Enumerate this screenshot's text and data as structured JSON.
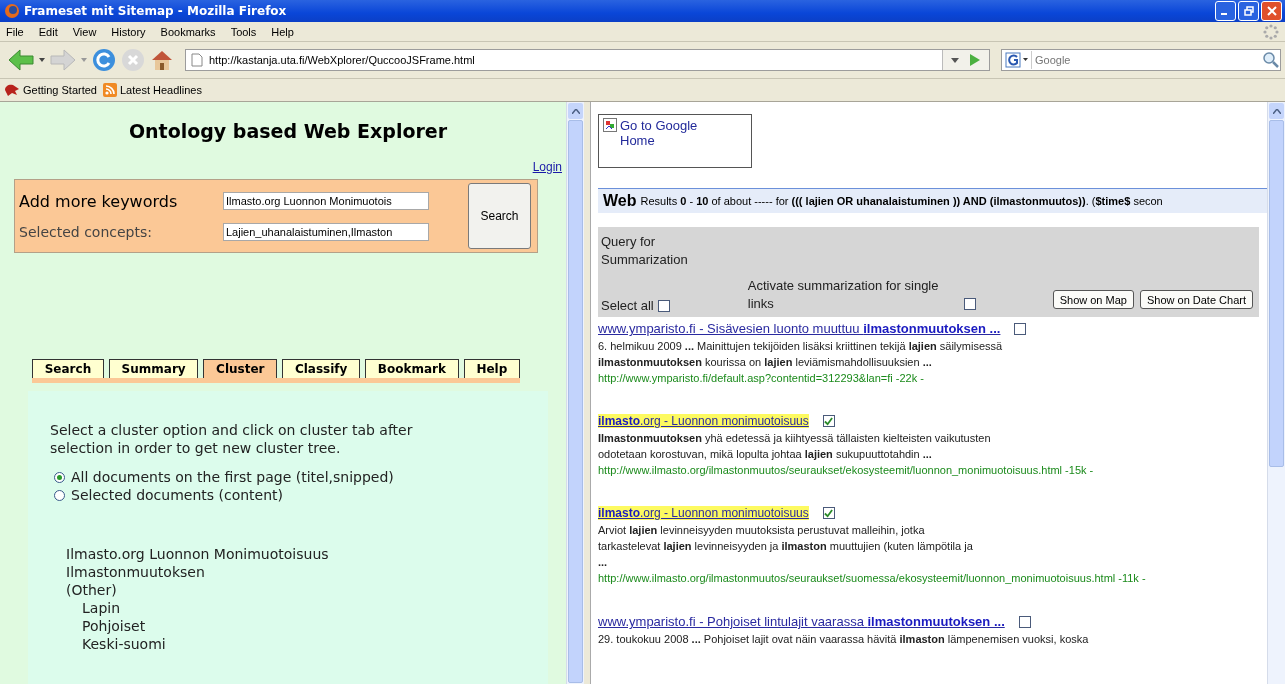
{
  "window": {
    "title": "Frameset mit Sitemap - Mozilla Firefox"
  },
  "menu": [
    "File",
    "Edit",
    "View",
    "History",
    "Bookmarks",
    "Tools",
    "Help"
  ],
  "address": {
    "url": "http://kastanja.uta.fi/WebXplorer/QuccooJSFrame.html"
  },
  "search": {
    "placeholder": "Google"
  },
  "bookmarks": [
    {
      "label": "Getting Started",
      "kind": "page"
    },
    {
      "label": "Latest Headlines",
      "kind": "feed"
    }
  ],
  "left": {
    "title": "Ontology based Web Explorer",
    "login": "Login",
    "keywords_label": "Add more keywords",
    "keywords_value": "Ilmasto.org Luonnon Monimuotois",
    "concepts_label": "Selected concepts:",
    "concepts_value": "Lajien_uhanalaistuminen,Ilmaston",
    "search_button": "Search",
    "tabs": [
      {
        "label": "Search",
        "selected": false
      },
      {
        "label": "Summary",
        "selected": false
      },
      {
        "label": "Cluster",
        "selected": true
      },
      {
        "label": "Classify",
        "selected": false
      },
      {
        "label": "Bookmark",
        "selected": false
      },
      {
        "label": "Help",
        "selected": false
      }
    ],
    "instructions": "Select a cluster option and click on cluster tab after selection in order to get new cluster tree.",
    "options": [
      {
        "label": "All documents on the first page (titel,snipped)",
        "selected": true
      },
      {
        "label": "Selected documents (content)",
        "selected": false
      }
    ],
    "tree": [
      {
        "label": "Ilmasto.org Luonnon Monimuotoisuus"
      },
      {
        "label": "Ilmastonmuutoksen"
      },
      {
        "label": "(Other)",
        "children": [
          {
            "label": "Lapin"
          },
          {
            "label": "Pohjoiset"
          },
          {
            "label": "Keski-suomi"
          }
        ]
      }
    ]
  },
  "right": {
    "home_link": "Go to Google Home",
    "web_label": "Web",
    "results_summary": "Results **0** - **10** of about ----- for **((( lajien OR uhanalaistuminen )) AND (ilmastonmuutos))**. (**$time$** secon",
    "query_label": "Query for Summarization",
    "select_all": {
      "label": "Select all",
      "checked": false
    },
    "activate": {
      "label": "Activate summarization for single links",
      "checked": false
    },
    "buttons": [
      "Show on Map",
      "Show on Date Chart"
    ],
    "results": [
      {
        "title": "www.ymparisto.fi - Sisävesien luonto muuttuu **ilmastonmuutoksen ...**",
        "highlighted": false,
        "checked": false,
        "snippet": [
          "6. helmikuu 2009 **...** Mainittujen tekijöiden lisäksi kriittinen tekijä **lajien** säilymisessä",
          "**ilmastonmuutoksen** kourissa on **lajien** leviämismahdollisuuksien **...**"
        ],
        "url": "http://www.ymparisto.fi/default.asp?contentid=312293&lan=fi -22k -"
      },
      {
        "title": "**ilmasto**.org - Luonnon monimuotoisuus",
        "highlighted": true,
        "checked": true,
        "snippet": [
          "**Ilmastonmuutoksen** yhä edetessä ja kiihtyessä tällaisten kielteisten vaikutusten",
          "odotetaan korostuvan, mikä lopulta johtaa **lajien** sukupuuttotahdin **...**"
        ],
        "url": "http://www.ilmasto.org/ilmastonmuutos/seuraukset/ekosysteemit/luonnon_monimuotoisuus.html -15k -"
      },
      {
        "title": "**ilmasto**.org - Luonnon monimuotoisuus",
        "highlighted": true,
        "checked": true,
        "snippet": [
          "Arviot **lajien** levinneisyyden muutoksista perustuvat malleihin, jotka",
          "tarkastelevat **lajien** levinneisyyden ja **ilmaston** muuttujien (kuten lämpötila ja",
          "**...**"
        ],
        "url": "http://www.ilmasto.org/ilmastonmuutos/seuraukset/suomessa/ekosysteemit/luonnon_monimuotoisuus.html -11k -"
      },
      {
        "title": "www.ymparisto.fi - Pohjoiset lintulajit vaarassa **ilmastonmuutoksen ...**",
        "highlighted": false,
        "checked": false,
        "snippet": [
          "29. toukokuu 2008 **...** Pohjoiset lajit ovat näin vaarassa hävitä **ilmaston** lämpenemisen vuoksi, koska"
        ]
      }
    ]
  }
}
